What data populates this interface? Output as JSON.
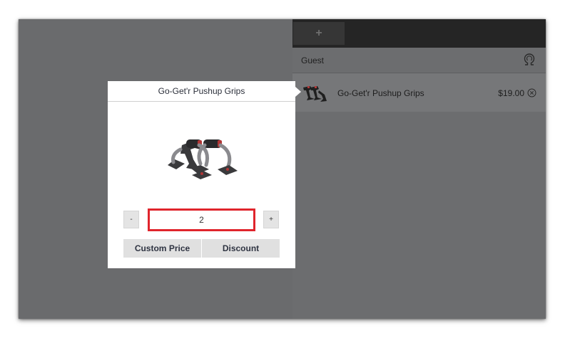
{
  "top_bar": {
    "new_tab_label": "+"
  },
  "customer": {
    "name": "Guest",
    "icon": "omega-customer-icon"
  },
  "cart": {
    "items": [
      {
        "name": "Go-Get'r Pushup Grips",
        "price": "$19.00",
        "thumb_icon": "pushup-grips-thumbnail"
      }
    ]
  },
  "modal": {
    "title": "Go-Get'r Pushup Grips",
    "product_image": "pushup-grips-image",
    "quantity": {
      "minus_label": "-",
      "value": "2",
      "plus_label": "+"
    },
    "custom_price_label": "Custom Price",
    "discount_label": "Discount"
  },
  "colors": {
    "overlay": "#6a6b6d",
    "top_bar": "#252525",
    "highlight": "#e0242c",
    "button_bg": "#e0e0e0"
  }
}
